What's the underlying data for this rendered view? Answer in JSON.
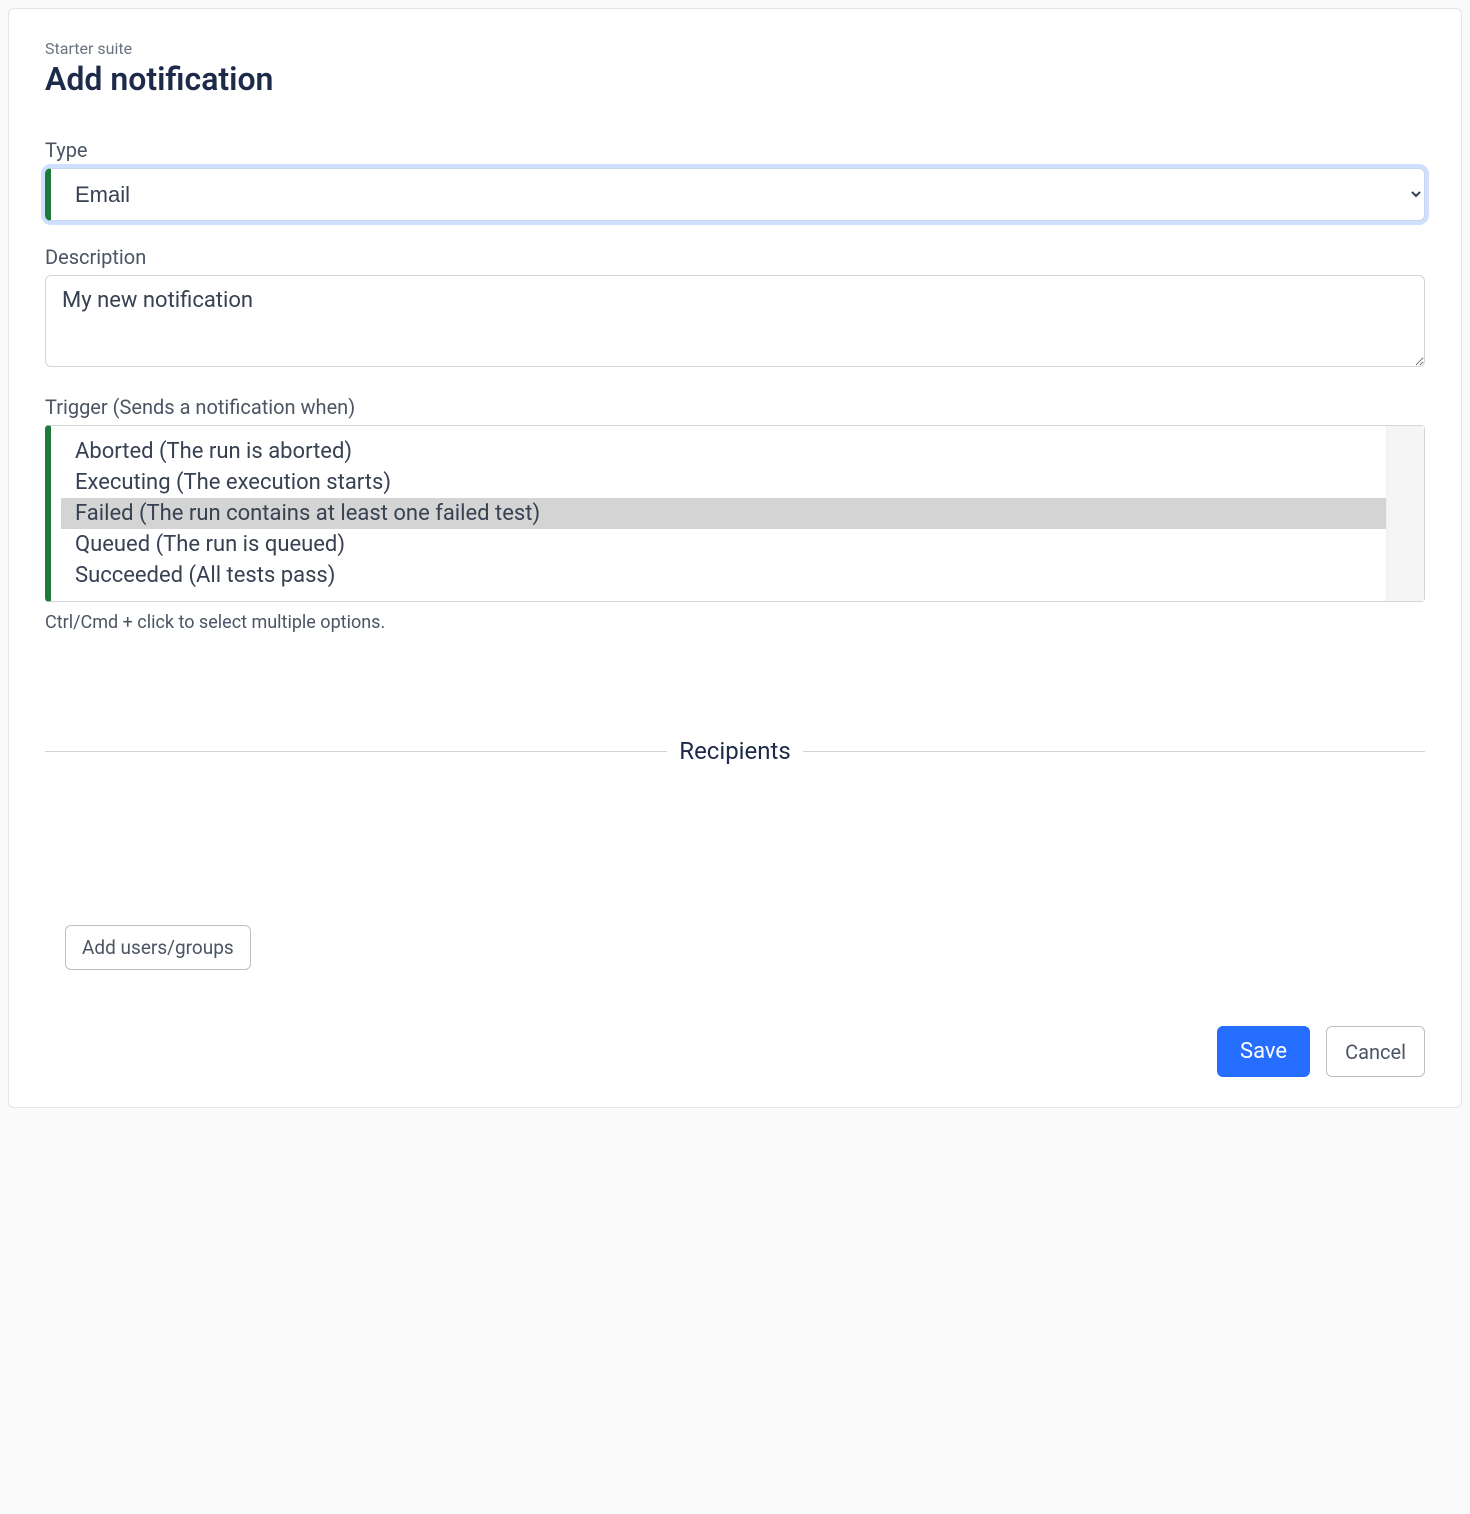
{
  "breadcrumb": "Starter suite",
  "page_title": "Add notification",
  "form": {
    "type": {
      "label": "Type",
      "value": "Email"
    },
    "description": {
      "label": "Description",
      "value": "My new notification"
    },
    "trigger": {
      "label": "Trigger (Sends a notification when)",
      "options": [
        {
          "label": "Aborted (The run is aborted)",
          "selected": false
        },
        {
          "label": "Executing (The execution starts)",
          "selected": false
        },
        {
          "label": "Failed (The run contains at least one failed test)",
          "selected": true
        },
        {
          "label": "Queued (The run is queued)",
          "selected": false
        },
        {
          "label": "Succeeded (All tests pass)",
          "selected": false
        }
      ],
      "helper": "Ctrl/Cmd + click to select multiple options."
    }
  },
  "recipients": {
    "heading": "Recipients",
    "add_button": "Add users/groups"
  },
  "footer": {
    "save": "Save",
    "cancel": "Cancel"
  }
}
